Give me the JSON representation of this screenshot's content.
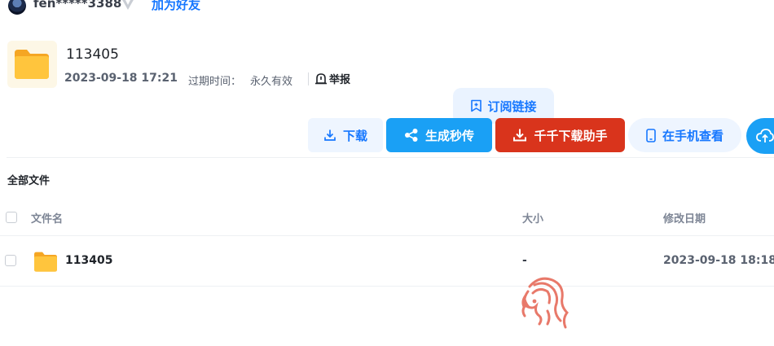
{
  "user": {
    "name": "fen*****3388",
    "badge_icon": "vip-v-icon",
    "add_friend": "加为好友"
  },
  "share": {
    "title": "113405",
    "date": "2023-09-18 17:21",
    "expire_label": "过期时间：",
    "expire_value": "永久有效",
    "report": "举报",
    "subscribe": "订阅链接"
  },
  "actions": {
    "download": "下载",
    "instant": "生成秒传",
    "helper": "千千下载助手",
    "mobile": "在手机查看"
  },
  "files": {
    "heading": "全部文件",
    "columns": {
      "name": "文件名",
      "size": "大小",
      "date": "修改日期"
    },
    "rows": [
      {
        "name": "113405",
        "size": "-",
        "date": "2023-09-18 18:18"
      }
    ]
  },
  "colors": {
    "accent": "#1677ff",
    "primary": "#1aa0f5",
    "danger": "#d9341c",
    "folder": "#ffc53d"
  }
}
